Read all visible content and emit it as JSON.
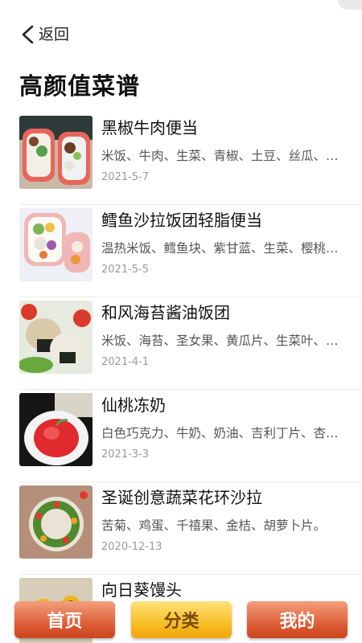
{
  "nav": {
    "back_label": "返回"
  },
  "page_title": "高颜值菜谱",
  "recipes": [
    {
      "name": "黑椒牛肉便当",
      "ingredients": "米饭、牛肉、生菜、青椒、土豆、丝瓜、…",
      "date": "2021-5-7",
      "thumb_icon": "bento-beef-photo"
    },
    {
      "name": "鳕鱼沙拉饭团轻脂便当",
      "ingredients": "温热米饭、鳕鱼块、紫甘蓝、生菜、樱桃…",
      "date": "2021-5-5",
      "thumb_icon": "cod-salad-bento-photo"
    },
    {
      "name": "和风海苔酱油饭团",
      "ingredients": "米饭、海苔、圣女果、黄瓜片、生菜叶、…",
      "date": "2021-4-1",
      "thumb_icon": "rice-ball-photo"
    },
    {
      "name": "仙桃冻奶",
      "ingredients": "白色巧克力、牛奶、奶油、吉利丁片、杏…",
      "date": "2021-3-3",
      "thumb_icon": "peach-pudding-photo"
    },
    {
      "name": "圣诞创意蔬菜花环沙拉",
      "ingredients": "苦菊、鸡蛋、千禧果、金桔、胡萝卜片。",
      "date": "2020-12-13",
      "thumb_icon": "wreath-salad-photo"
    },
    {
      "name": "向日葵馒头",
      "ingredients": "",
      "date": "",
      "thumb_icon": "sunflower-bun-photo"
    }
  ],
  "tabbar": {
    "home": "首页",
    "category": "分类",
    "mine": "我的"
  },
  "colors": {
    "tab_orange": "#d9562f",
    "tab_yellow": "#f7b81b",
    "divider": "#ececec"
  }
}
